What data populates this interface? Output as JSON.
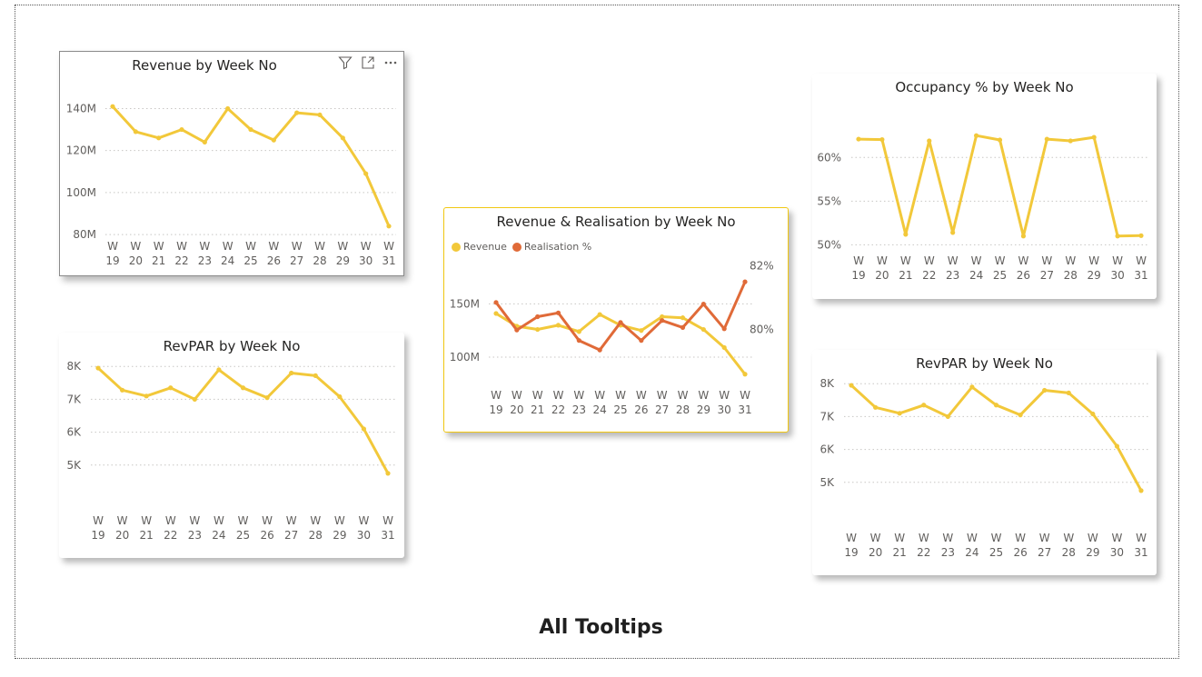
{
  "page": {
    "footer_title": "All Tooltips"
  },
  "colors": {
    "revenue": "#F2C83A",
    "realisation": "#E06A38",
    "grid": "#C8C6C4",
    "axis_text": "#605E5C"
  },
  "icons": [
    "filter-icon",
    "focus-mode-icon",
    "more-options-icon"
  ],
  "chart_data": [
    {
      "id": "revenue-by-week",
      "type": "line",
      "title": "Revenue by Week No",
      "categories": [
        "W 19",
        "W 20",
        "W 21",
        "W 22",
        "W 23",
        "W 24",
        "W 25",
        "W 26",
        "W 27",
        "W 28",
        "W 29",
        "W 30",
        "W 31"
      ],
      "series": [
        {
          "values": [
            141,
            129,
            126,
            130,
            124,
            140,
            130,
            125,
            138,
            137,
            126,
            109,
            84
          ]
        }
      ],
      "y_ticks": [
        {
          "value": 80,
          "label": "80M"
        },
        {
          "value": 100,
          "label": "100M"
        },
        {
          "value": 120,
          "label": "120M"
        },
        {
          "value": 140,
          "label": "140M"
        }
      ],
      "ylim": [
        77,
        148
      ],
      "grid": true
    },
    {
      "id": "revpar-left",
      "type": "line",
      "title": "RevPAR by Week No",
      "categories": [
        "W 19",
        "W 20",
        "W 21",
        "W 22",
        "W 23",
        "W 24",
        "W 25",
        "W 26",
        "W 27",
        "W 28",
        "W 29",
        "W 30",
        "W 31"
      ],
      "series": [
        {
          "values": [
            7.95,
            7.28,
            7.1,
            7.35,
            7.0,
            7.9,
            7.35,
            7.05,
            7.8,
            7.72,
            7.08,
            6.1,
            4.75
          ]
        }
      ],
      "y_ticks": [
        {
          "value": 5,
          "label": "5K"
        },
        {
          "value": 6,
          "label": "6K"
        },
        {
          "value": 7,
          "label": "7K"
        },
        {
          "value": 8,
          "label": "8K"
        }
      ],
      "ylim": [
        4.0,
        8.2
      ],
      "grid": true
    },
    {
      "id": "revenue-realisation",
      "type": "line",
      "title": "Revenue & Realisation by Week No",
      "categories": [
        "W 19",
        "W 20",
        "W 21",
        "W 22",
        "W 23",
        "W 24",
        "W 25",
        "W 26",
        "W 27",
        "W 28",
        "W 29",
        "W 30",
        "W 31"
      ],
      "series": [
        {
          "name": "Revenue",
          "axis": "left",
          "values": [
            141,
            129,
            126,
            130,
            124,
            140,
            130,
            125,
            138,
            137,
            126,
            109,
            84
          ]
        },
        {
          "name": "Realisation %",
          "axis": "right",
          "values": [
            80.85,
            79.98,
            80.4,
            80.52,
            79.65,
            79.35,
            80.22,
            79.65,
            80.28,
            80.06,
            80.8,
            80.02,
            81.5
          ]
        }
      ],
      "y_ticks": [
        {
          "value": 100,
          "label": "100M"
        },
        {
          "value": 150,
          "label": "150M"
        }
      ],
      "y2_ticks": [
        {
          "value": 80,
          "label": "80%"
        },
        {
          "value": 82,
          "label": "82%"
        }
      ],
      "ylim": [
        71,
        199
      ],
      "y2lim": [
        78.15,
        82.45
      ],
      "grid": true
    },
    {
      "id": "occupancy-by-week",
      "type": "line",
      "title": "Occupancy % by Week No",
      "categories": [
        "W 19",
        "W 20",
        "W 21",
        "W 22",
        "W 23",
        "W 24",
        "W 25",
        "W 26",
        "W 27",
        "W 28",
        "W 29",
        "W 30",
        "W 31"
      ],
      "series": [
        {
          "values": [
            62.1,
            62.05,
            51.2,
            61.9,
            51.4,
            62.5,
            62.0,
            51.0,
            62.1,
            61.9,
            62.3,
            51.0,
            51.05
          ]
        }
      ],
      "y_ticks": [
        {
          "value": 50,
          "label": "50%"
        },
        {
          "value": 55,
          "label": "55%"
        },
        {
          "value": 60,
          "label": "60%"
        }
      ],
      "ylim": [
        49.0,
        64.5
      ],
      "grid": true
    },
    {
      "id": "revpar-right",
      "type": "line",
      "title": "RevPAR by Week No",
      "categories": [
        "W 19",
        "W 20",
        "W 21",
        "W 22",
        "W 23",
        "W 24",
        "W 25",
        "W 26",
        "W 27",
        "W 28",
        "W 29",
        "W 30",
        "W 31"
      ],
      "series": [
        {
          "values": [
            7.95,
            7.28,
            7.1,
            7.35,
            7.0,
            7.9,
            7.35,
            7.05,
            7.8,
            7.72,
            7.08,
            6.1,
            4.75
          ]
        }
      ],
      "y_ticks": [
        {
          "value": 5,
          "label": "5K"
        },
        {
          "value": 6,
          "label": "6K"
        },
        {
          "value": 7,
          "label": "7K"
        },
        {
          "value": 8,
          "label": "8K"
        }
      ],
      "ylim": [
        4.0,
        8.2
      ],
      "grid": true
    }
  ]
}
